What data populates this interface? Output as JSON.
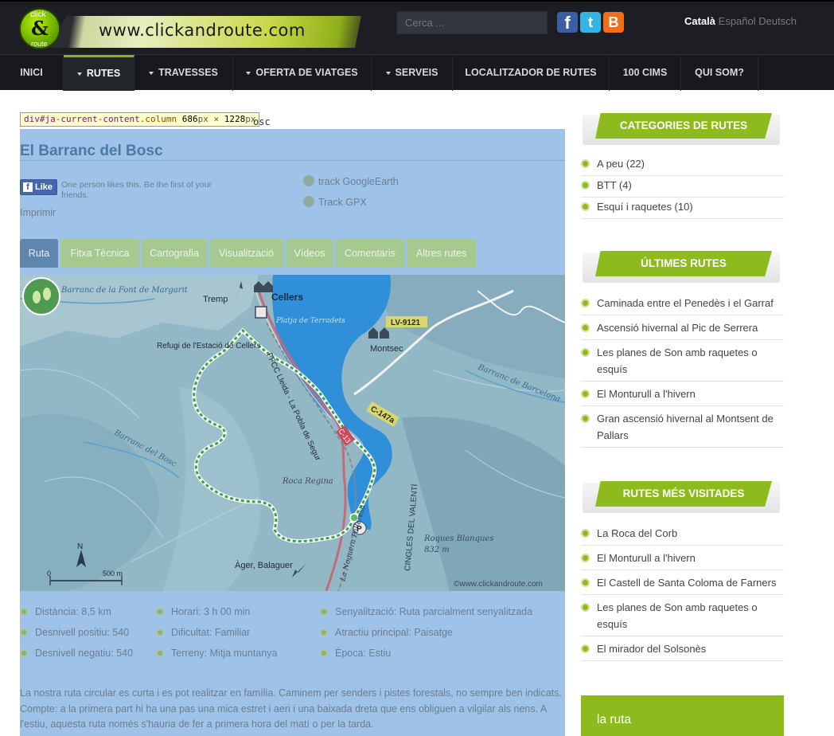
{
  "header": {
    "logo_small_top": "click",
    "logo_amp": "&",
    "logo_small_bottom": "route",
    "logo_url": "www.clickandroute.com",
    "search_placeholder": "Cerca ...",
    "languages": {
      "active": "Català",
      "others": "Español Deutsch"
    }
  },
  "nav": {
    "items": [
      {
        "label": "INICI",
        "dropdown": false,
        "active": false
      },
      {
        "label": "RUTES",
        "dropdown": true,
        "active": true
      },
      {
        "label": "TRAVESSES",
        "dropdown": true,
        "active": false
      },
      {
        "label": "OFERTA DE VIATGES",
        "dropdown": true,
        "active": false
      },
      {
        "label": "SERVEIS",
        "dropdown": true,
        "active": false
      },
      {
        "label": "LOCALITZADOR DE RUTES",
        "dropdown": false,
        "active": false
      },
      {
        "label": "100 CIMS",
        "dropdown": false,
        "active": false
      },
      {
        "label": "QUI SOM?",
        "dropdown": false,
        "active": false
      }
    ]
  },
  "devtools": {
    "tag": "div",
    "selector": "#ja-current-content",
    "class_name": ".column",
    "width": "686",
    "height": "1228",
    "unit": "px",
    "times": "×",
    "overflow_text": "osc"
  },
  "route": {
    "title": "El Barranc del Bosc",
    "like_label": "Like",
    "like_text": "One person likes this. Be the first of your friends.",
    "print": "Imprimir",
    "downloads": [
      "track GoogleEarth",
      "Track GPX"
    ],
    "tabs": [
      "Ruta",
      "Fitxa Tècnica",
      "Cartografia",
      "Visualització",
      "Vídeos",
      "Comentaris",
      "Altres rutes"
    ],
    "active_tab": "Ruta",
    "map": {
      "labels": {
        "barranc_font": "Barranc de la Font de Margarit",
        "tremp": "Tremp",
        "cellers": "Cellers",
        "platja": "Platja de Terradets",
        "lv_road": "LV-9121",
        "montsec": "Montsec",
        "refugi": "Refugi de l'Estació de Cellers",
        "railway": "FFCC Lleida - La Pobla de Segur",
        "c13": "C-13",
        "c147a": "C-147a",
        "barranc_barcelona": "Barranc de Barcelona",
        "barranc_bosc": "Barranc del Bosc",
        "roca_regina": "Roca Regina",
        "cingles": "CINGLES DEL VALENTÍ",
        "roques_blanques": "Roques Blanques",
        "alt": "832 m",
        "noguera": "La Noguera Pallaresa",
        "ager": "Àger, Balaguer",
        "parking": "P",
        "north": "N",
        "scale_0": "0",
        "scale_500": "500 m",
        "copyright": "©www.clickandroute.com"
      }
    },
    "facts": [
      {
        "label": "Distància",
        "value": "8,5 km"
      },
      {
        "label": "Horari",
        "value": "3 h 00 min"
      },
      {
        "label": "Senyalització",
        "value": "Ruta parcialment senyalitzada"
      },
      {
        "label": "Desnivell positiu",
        "value": "540"
      },
      {
        "label": "Dificultat",
        "value": "Familiar"
      },
      {
        "label": "Atractiu principal",
        "value": "Paisatge"
      },
      {
        "label": "Desnivell negatiu",
        "value": "540"
      },
      {
        "label": "Terreny",
        "value": "Mitja muntanya"
      },
      {
        "label": "Època",
        "value": "Estiu"
      }
    ],
    "description": "La nostra ruta circular es curta i es pot realitzar en família. Caminem per senders i pistes forestals, no sempre ben indicats. Compte: a la primera part hi ha una pas una mica estret i aeri i una baixada dreta que ens obliguen a vilgilar als nens. A l'estiu, aquesta ruta només s'hauria de fer a primera hora del matí o per la tarda."
  },
  "sidebar": {
    "categories": {
      "title": "CATEGORIES DE RUTES",
      "items": [
        "A peu  (22)",
        "BTT  (4)",
        "Esquí i raquetes  (10)"
      ]
    },
    "latest": {
      "title": "ÚLTIMES RUTES",
      "items": [
        "Caminada entre el Penedès i el Garraf",
        "Ascensió hivernal al Pic de Serrera",
        "Les planes de Son amb raquetes o esquís",
        "El Monturull a l'hivern",
        "Gran ascensió hivernal al Montsent de Pallars"
      ]
    },
    "most_visited": {
      "title": "RUTES MÉS VISITADES",
      "items": [
        "La Roca del Corb",
        "El Monturull a l'hivern",
        "El Castell de Santa Coloma de Farners",
        "Les planes de Son amb raquetes o esquís",
        "El mirador del Solsonès"
      ]
    },
    "route_box_title": "la ruta"
  },
  "colors": {
    "header_bg": "#1c1e23",
    "nav_bg": "#17191d",
    "accent_green": "#8dbb1e",
    "devtools_overlay": "#9fc3e8",
    "facebook": "#3b5ea3",
    "twitter": "#34b5e3",
    "blogger": "#f26c1a"
  },
  "icons": {
    "social": [
      "facebook-icon",
      "twitter-icon",
      "blogger-icon"
    ],
    "download": "download-icon",
    "bullet": "green-bullet-icon",
    "hiker": "hiker-badge-icon"
  }
}
